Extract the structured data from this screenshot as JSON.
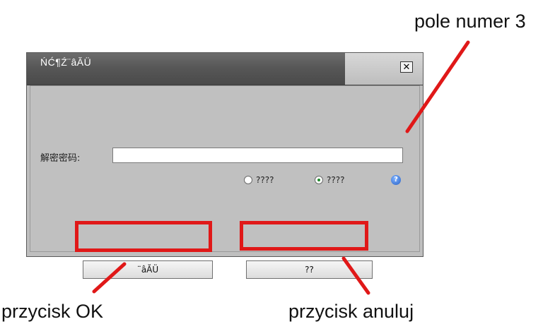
{
  "annotations": {
    "top_label": "pole numer 3",
    "ok_label": "przycisk OK",
    "cancel_label": "przycisk anuluj"
  },
  "dialog": {
    "title": "ŃĆ¶Ź¨âĂÜ",
    "close_glyph": "✕",
    "password_label": "解密密码:",
    "password_value": "",
    "radio_options": [
      {
        "label": "????",
        "checked": false
      },
      {
        "label": "????",
        "checked": true
      }
    ],
    "help_glyph": "?",
    "ok_button_label": "¨âĂÜ",
    "cancel_button_label": "??"
  },
  "colors": {
    "annotation_red": "#e01818",
    "dialog_body": "#c0c0c0",
    "titlebar_dark": "#575757"
  }
}
